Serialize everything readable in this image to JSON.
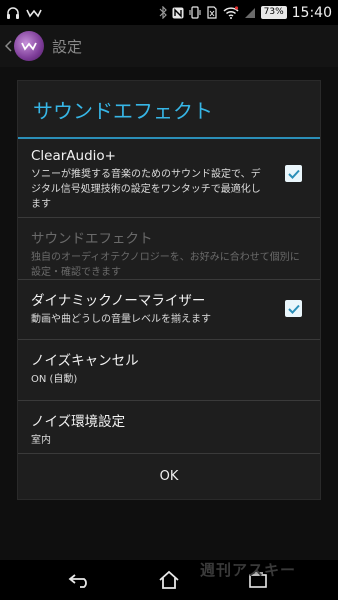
{
  "status_bar": {
    "battery": "73%",
    "time": "15:40"
  },
  "action_bar": {
    "title": "設定"
  },
  "dialog": {
    "title": "サウンドエフェクト",
    "items": [
      {
        "title": "ClearAudio+",
        "description": "ソニーが推奨する音楽のためのサウンド設定で、デジタル信号処理技術の設定をワンタッチで最適化します",
        "checked": true,
        "enabled": true
      },
      {
        "title": "サウンドエフェクト",
        "description": "独自のオーディオテクノロジーを、お好みに合わせて個別に設定・確認できます",
        "enabled": false
      },
      {
        "title": "ダイナミックノーマライザー",
        "description": "動画や曲どうしの音量レベルを揃えます",
        "checked": true,
        "enabled": true
      },
      {
        "title": "ノイズキャンセル",
        "description": "ON (自動)",
        "enabled": true
      },
      {
        "title": "ノイズ環境設定",
        "description": "室内",
        "enabled": true
      }
    ],
    "ok_label": "OK"
  },
  "watermark": "週刊アスキー",
  "colors": {
    "accent": "#37b6e6",
    "divider": "#2b8fb8",
    "dialog_bg": "#1e1e1e"
  }
}
